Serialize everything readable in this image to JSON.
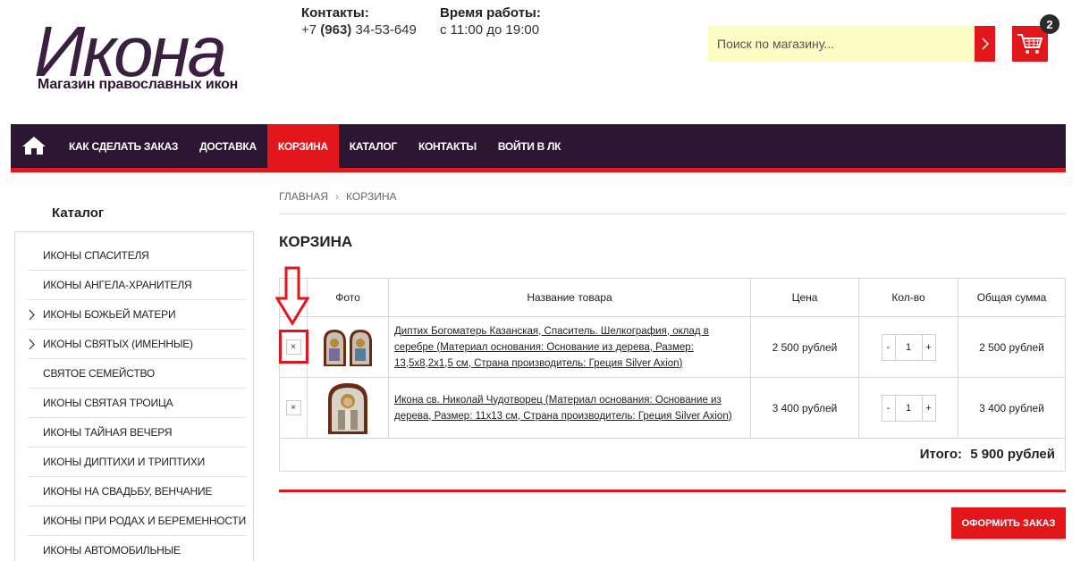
{
  "brand": {
    "logo_title": "Икона",
    "logo_subtitle": "Магазин православных икон"
  },
  "header": {
    "contacts_label": "Контакты:",
    "phone_prefix": "+7 ",
    "phone_code": "(963)",
    "phone_number": " 34-53-649",
    "hours_label": "Время работы:",
    "hours_value": "с 11:00 до 19:00",
    "search_placeholder": "Поиск по магазину...",
    "cart_count": "2"
  },
  "colors": {
    "accent": "#e2161b",
    "nav_bg": "#2c1631",
    "search_bg": "#fbfdc5"
  },
  "nav": {
    "home_icon": "home-icon",
    "items": [
      {
        "label": "КАК СДЕЛАТЬ ЗАКАЗ"
      },
      {
        "label": "ДОСТАВКА"
      },
      {
        "label": "КОРЗИНА"
      },
      {
        "label": "КАТАЛОГ"
      },
      {
        "label": "КОНТАКТЫ"
      },
      {
        "label": "ВОЙТИ В ЛК"
      }
    ]
  },
  "sidebar": {
    "title": "Каталог",
    "items": [
      {
        "label": "ИКОНЫ СПАСИТЕЛЯ"
      },
      {
        "label": "ИКОНЫ АНГЕЛА-ХРАНИТЕЛЯ"
      },
      {
        "label": "ИКОНЫ БОЖЬЕЙ МАТЕРИ"
      },
      {
        "label": "ИКОНЫ СВЯТЫХ (ИМЕННЫЕ)"
      },
      {
        "label": "СВЯТОЕ СЕМЕЙСТВО"
      },
      {
        "label": "ИКОНЫ СВЯТАЯ ТРОИЦА"
      },
      {
        "label": "ИКОНЫ ТАЙНАЯ ВЕЧЕРЯ"
      },
      {
        "label": "ИКОНЫ ДИПТИХИ И ТРИПТИХИ"
      },
      {
        "label": "ИКОНЫ НА СВАДЬБУ, ВЕНЧАНИЕ"
      },
      {
        "label": "ИКОНЫ ПРИ РОДАХ И БЕРЕМЕННОСТИ"
      },
      {
        "label": "ИКОНЫ АВТОМОБИЛЬНЫЕ"
      }
    ]
  },
  "breadcrumb": {
    "home": "ГЛАВНАЯ",
    "separator": "›",
    "current": "КОРЗИНА"
  },
  "page": {
    "title": "КОРЗИНА"
  },
  "cart": {
    "columns": {
      "photo": "Фото",
      "name": "Название товара",
      "price": "Цена",
      "qty": "Кол-во",
      "sum": "Общая сумма"
    },
    "rows": [
      {
        "remove": "×",
        "name": "Диптих Богоматерь Казанская, Спаситель. Шелкография, оклад в серебре (Материал основания: Основание из дерева, Размер: 13,5х8,2х1,5 см, Страна производитель: Греция Silver Axion)",
        "price": "2 500 рублей",
        "minus": "-",
        "qty": "1",
        "plus": "+",
        "sum": "2 500 рублей"
      },
      {
        "remove": "×",
        "name": "Икона св. Николай Чудотворец (Материал основания: Основание из дерева, Размер: 11х13 см, Страна производитель: Греция Silver Axion)",
        "price": "3 400 рублей",
        "minus": "-",
        "qty": "1",
        "plus": "+",
        "sum": "3 400 рублей"
      }
    ],
    "total_label": "Итого:",
    "total_value": "5 900 рублей",
    "checkout_label": "ОФОРМИТЬ ЗАКАЗ"
  }
}
